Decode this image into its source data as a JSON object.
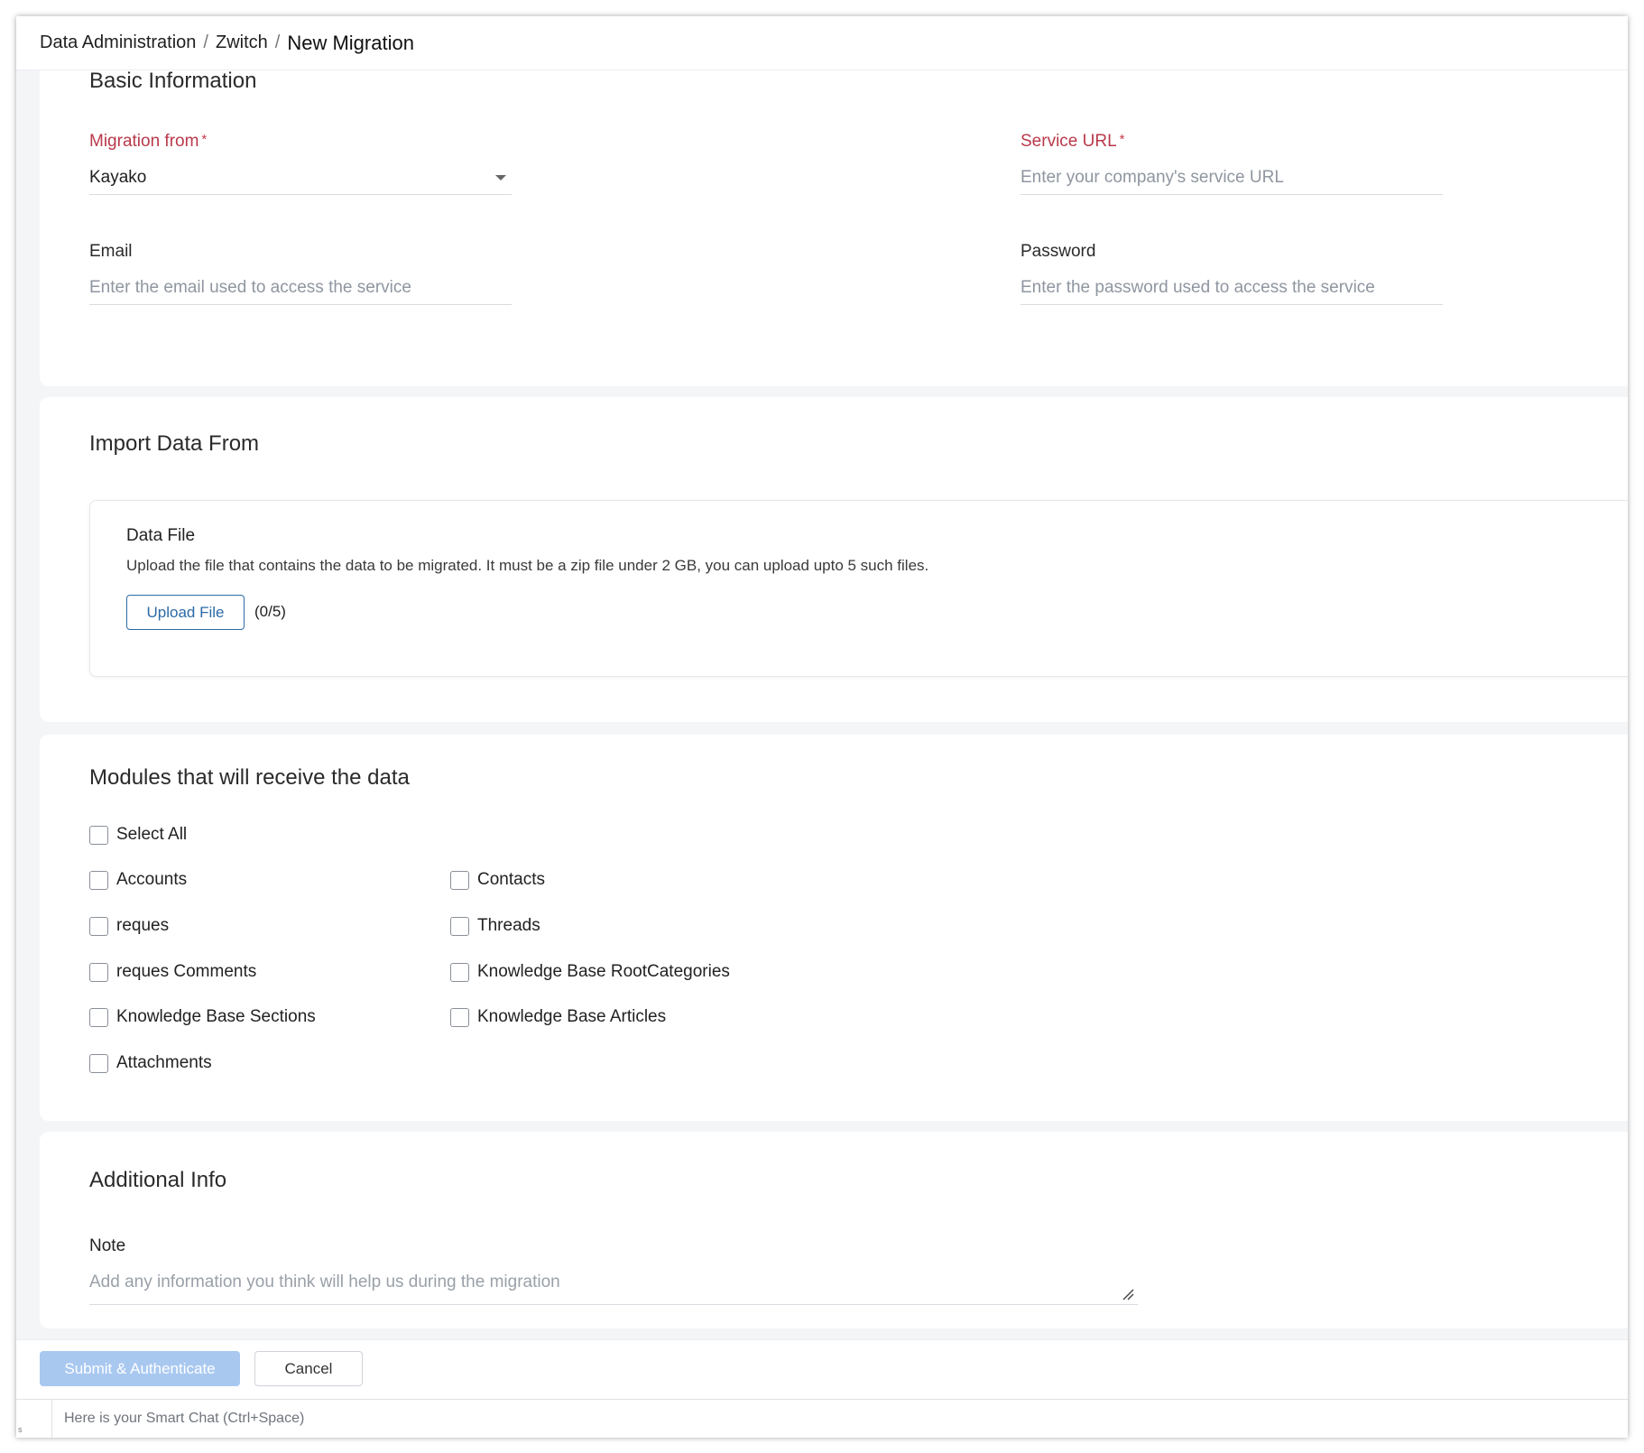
{
  "breadcrumb": {
    "items": [
      "Data Administration",
      "Zwitch"
    ],
    "separator": "/",
    "current": "New Migration"
  },
  "basic_info": {
    "title": "Basic Information",
    "migration_from": {
      "label": "Migration from",
      "required_mark": "*",
      "value": "Kayako"
    },
    "service_url": {
      "label": "Service URL",
      "required_mark": "*",
      "placeholder": "Enter your company's service URL"
    },
    "email": {
      "label": "Email",
      "placeholder": "Enter the email used to access the service"
    },
    "password": {
      "label": "Password",
      "placeholder": "Enter the password used to access the service"
    }
  },
  "import_data": {
    "title": "Import Data From",
    "data_file": {
      "title": "Data File",
      "description": "Upload the file that contains the data to be migrated. It must be a zip file under 2 GB, you can upload upto 5 such files.",
      "upload_label": "Upload File",
      "count": "(0/5)"
    }
  },
  "modules": {
    "title": "Modules that will receive the data",
    "select_all": "Select All",
    "items": [
      "Accounts",
      "Contacts",
      "reques",
      "Threads",
      "reques Comments",
      "Knowledge Base RootCategories",
      "Knowledge Base Sections",
      "Knowledge Base Articles",
      "Attachments"
    ]
  },
  "additional_info": {
    "title": "Additional Info",
    "note_label": "Note",
    "note_placeholder": "Add any information you think will help us during the migration"
  },
  "footer": {
    "submit_label": "Submit & Authenticate",
    "cancel_label": "Cancel"
  },
  "smart_chat": {
    "left_glyph": "s",
    "placeholder": "Here is your Smart Chat (Ctrl+Space)"
  },
  "colors": {
    "required": "#b9394a",
    "link_blue": "#2c6aa8",
    "submit_disabled": "#a8c8f0",
    "page_bg": "#f4f5f7"
  },
  "icons": {
    "dropdown": "chevron-down-icon",
    "checkbox": "checkbox-unchecked-icon",
    "textarea_resize": "resize-handle-icon"
  }
}
